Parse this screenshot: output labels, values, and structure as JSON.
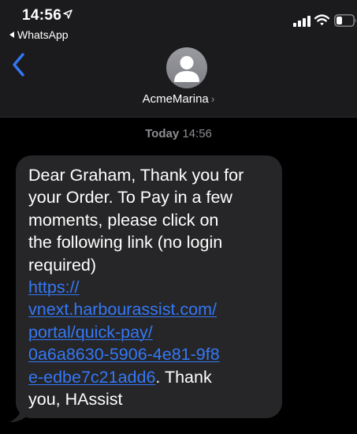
{
  "status_bar": {
    "time": "14:56",
    "back_app_label": "WhatsApp"
  },
  "header": {
    "contact_name": "AcmeMarina",
    "chevron": "›"
  },
  "conversation": {
    "timestamp_day": "Today",
    "timestamp_time": "14:56",
    "message": {
      "text_lines": [
        "Dear Graham, Thank you for",
        "your Order.  To Pay in a few",
        "moments, please click on",
        "the following link (no login",
        "required)"
      ],
      "link_lines": [
        "https://",
        "vnext.harbourassist.com/",
        "portal/quick-pay/",
        "0a6a8630-5906-4e81-9f8",
        "e-edbe7c21add6"
      ],
      "after_link": ".  Thank",
      "closing": "you, HAssist"
    }
  },
  "colors": {
    "link": "#3478f6",
    "bubble": "#262628",
    "header_bg": "#1b1b1d",
    "muted": "#8e8e93"
  },
  "icons": {
    "location": "location-arrow-icon",
    "back_app": "back-triangle-icon",
    "signal": "cellular-signal-icon",
    "wifi": "wifi-icon",
    "battery": "battery-icon",
    "nav_back": "chevron-left-icon",
    "avatar": "person-avatar-icon",
    "contact_chevron": "chevron-right-icon"
  }
}
